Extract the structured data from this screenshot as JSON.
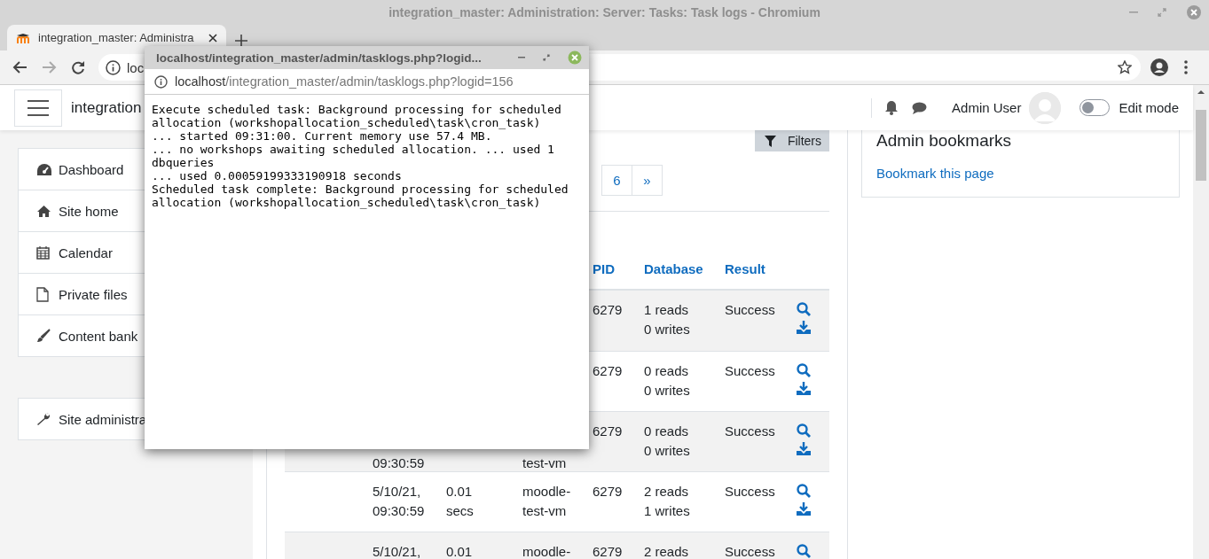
{
  "window": {
    "title": "integration_master: Administration: Server: Tasks: Task logs - Chromium"
  },
  "browser": {
    "tabs": [
      {
        "title": "integration_master: Administra",
        "selected": true
      }
    ],
    "address": "loc"
  },
  "navbar": {
    "site_name": "integration",
    "user_name": "Admin User",
    "edit_mode": {
      "label": "Edit mode",
      "on": false
    }
  },
  "sidebar": {
    "groups": [
      {
        "items": [
          {
            "label": "Dashboard",
            "kind": "dashboard"
          },
          {
            "label": "Site home",
            "kind": "home"
          },
          {
            "label": "Calendar",
            "kind": "calendar"
          },
          {
            "label": "Private files",
            "kind": "file"
          },
          {
            "label": "Content bank",
            "kind": "brush"
          }
        ]
      },
      {
        "items": [
          {
            "label": "Site administra",
            "kind": "wrench"
          }
        ]
      }
    ]
  },
  "main": {
    "filters_button": "Filters",
    "pagination": [
      {
        "label": "6",
        "selected": false
      },
      {
        "label": "»",
        "selected": false
      }
    ],
    "table": {
      "columns": [
        "PID",
        "Database",
        "Result"
      ],
      "rows": [
        {
          "striped": true,
          "pid": [
            "6279"
          ],
          "database": [
            "1 reads",
            "0 writes"
          ],
          "result": [
            "Success"
          ]
        },
        {
          "striped": false,
          "pid": [
            "6279"
          ],
          "database": [
            "0 reads",
            "0 writes"
          ],
          "result": [
            "Success"
          ]
        },
        {
          "striped": true,
          "column_2": {
            "lines": [
              "09:30:59"
            ],
            "kind": "continuation"
          },
          "column_4": {
            "lines": [
              "test-vm"
            ],
            "kind": "continuation"
          },
          "pid": [
            "6279"
          ],
          "database": [
            "0 reads",
            "0 writes"
          ],
          "result": [
            "Success"
          ]
        },
        {
          "striped": false,
          "column_2": [
            "5/10/21,",
            "09:30:59"
          ],
          "column_3": [
            "0.01",
            "secs"
          ],
          "column_4": [
            "moodle-",
            "test-vm"
          ],
          "pid": [
            "6279"
          ],
          "database": [
            "2 reads",
            "1 writes"
          ],
          "result": [
            "Success"
          ]
        },
        {
          "striped": true,
          "column_2": [
            "5/10/21,"
          ],
          "column_3": [
            "0.01"
          ],
          "column_4": [
            "moodle-"
          ],
          "pid": [
            "6279"
          ],
          "database": [
            "2 reads"
          ],
          "result": [
            "Success"
          ]
        }
      ]
    }
  },
  "block": {
    "title": "Admin bookmarks",
    "link": "Bookmark this page"
  },
  "popup": {
    "title": "localhost/integration_master/admin/tasklogs.php?logid...",
    "url_host": "localhost",
    "url_path": "/integration_master/admin/tasklogs.php?logid=156",
    "log_lines": [
      "Execute scheduled task: Background processing for scheduled",
      "allocation (workshopallocation_scheduled\\task\\cron_task)",
      "... started 09:31:00. Current memory use 57.4 MB.",
      "... no workshops awaiting scheduled allocation. ... used 1",
      "dbqueries",
      "... used 0.00059199333190918 seconds",
      "Scheduled task complete: Background processing for scheduled",
      "allocation (workshopallocation_scheduled\\task\\cron_task)"
    ]
  }
}
